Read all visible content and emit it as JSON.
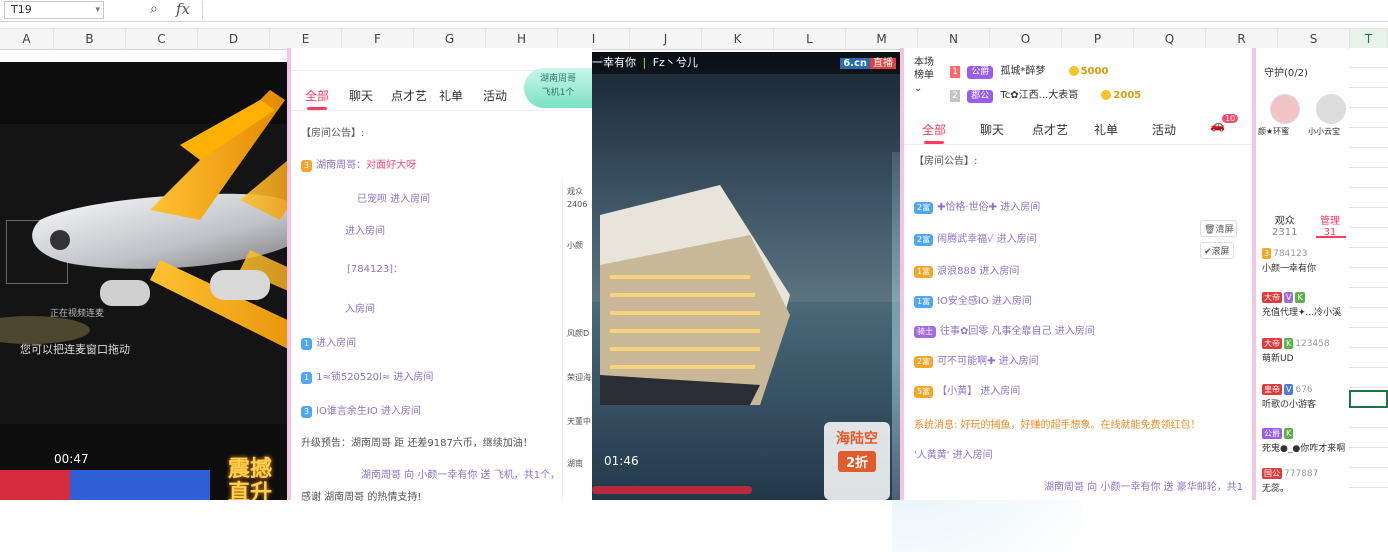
{
  "spreadsheet": {
    "name_box": "T19",
    "fx_label": "fx",
    "columns": [
      "A",
      "B",
      "C",
      "D",
      "E",
      "F",
      "G",
      "H",
      "I",
      "J",
      "K",
      "L",
      "M",
      "N",
      "O",
      "P",
      "Q",
      "R",
      "S",
      "T"
    ]
  },
  "left_stream": {
    "video_hint_1": "正在视频连麦",
    "video_hint_2": "您可以把连麦窗口拖动",
    "time": "00:47",
    "promo": "震撼直升",
    "side_banner_1": "湖南周哥",
    "side_banner_2": "飞机1个",
    "chat_tabs": [
      "全部",
      "聊天",
      "点才艺",
      "礼单",
      "活动"
    ],
    "announcement": "【房间公告】:",
    "messages": [
      {
        "level": "3",
        "text": "湖南周哥：",
        "highlight": "对面好大呀"
      },
      {
        "level": "",
        "text": "已宠呗 进入房间"
      },
      {
        "level": "",
        "text": "进入房间"
      },
      {
        "level": "",
        "text": "[784123]："
      },
      {
        "level": "",
        "text": "入房间"
      },
      {
        "level": "1",
        "text": "进入房间"
      },
      {
        "level": "1",
        "text": "1≈锁520520l≈ 进入房间"
      },
      {
        "level": "3",
        "text": "IO谁言余生IO 进入房间"
      }
    ],
    "upgrade_text": "升级预告：湖南周哥 距 还差9187六币，继续加油！",
    "gift_text": "湖南周哥 向 小颜一幸有你 送 飞机，共1个，",
    "thanks_text": "感谢 湖南周哥 的热情支持!",
    "audience_label": "观众",
    "audience_count": "2406",
    "side_items": [
      "小颜",
      "风颜D",
      "荣迎海",
      "天董中",
      "湖南"
    ]
  },
  "right_stream": {
    "header_name": "一幸有你",
    "header_sub": "Fz丶兮儿",
    "logo": "6.cn",
    "live": "直播",
    "time": "01:46",
    "sale_title": "海陆空",
    "sale_discount": "2折",
    "rank_label_1": "本场",
    "rank_label_2": "榜单",
    "rank": [
      {
        "pos": "1",
        "badge": "公爵",
        "name": "孤城*醉梦",
        "coins": "5000"
      },
      {
        "pos": "2",
        "badge": "郡公",
        "name": "Tc✿江西...大表哥",
        "coins": "2005"
      }
    ],
    "chat_tabs": [
      "全部",
      "聊天",
      "点才艺",
      "礼单",
      "活动"
    ],
    "tab_badge": "10",
    "announcement": "【房间公告】:",
    "clear_label": "清屏",
    "scroll_label": "滚屏",
    "messages": [
      {
        "level": "2富",
        "text": "✚恰格·世俗✚ 进入房间"
      },
      {
        "level": "2富",
        "text": "闹腾武幸福√ 进入房间"
      },
      {
        "level": "1富",
        "text": "浪浪888 进入房间"
      },
      {
        "level": "1富",
        "text": "IO安全感IO 进入房间"
      },
      {
        "level": "骑士",
        "text": "往事✿回零 凡事全靠自己 进入房间"
      },
      {
        "level": "2富",
        "text": "可不可能啊✚ 进入房间"
      },
      {
        "level": "5富",
        "text": "【小黄】 进入房间"
      }
    ],
    "system_msg": "系统消息: 好玩的捕鱼，好赚的超手想象。在线就能免费领红包！",
    "visitor_msg": "'人黄黄' 进入房间",
    "gift_msg": "湖南周哥 向 小颜一幸有你 送 豪华邮轮，共1",
    "guard_label": "守护(0/2)",
    "guards": [
      "颜★环蜜",
      "小小云宝"
    ],
    "viewers_label": "观众",
    "viewers_count": "2311",
    "admin_label": "管理",
    "admin_count": "31",
    "users": [
      {
        "id": "784123",
        "name": "小颜一幸有你"
      },
      {
        "id": "",
        "name": "充值代理✦...冷小溪"
      },
      {
        "id": "123458",
        "name": "萌新UD"
      },
      {
        "id": "676",
        "name": "听歌の小游客"
      },
      {
        "id": "",
        "name": "死鬼●_●你咋才来啊"
      },
      {
        "id": "777887",
        "name": "无蕊。"
      }
    ]
  }
}
